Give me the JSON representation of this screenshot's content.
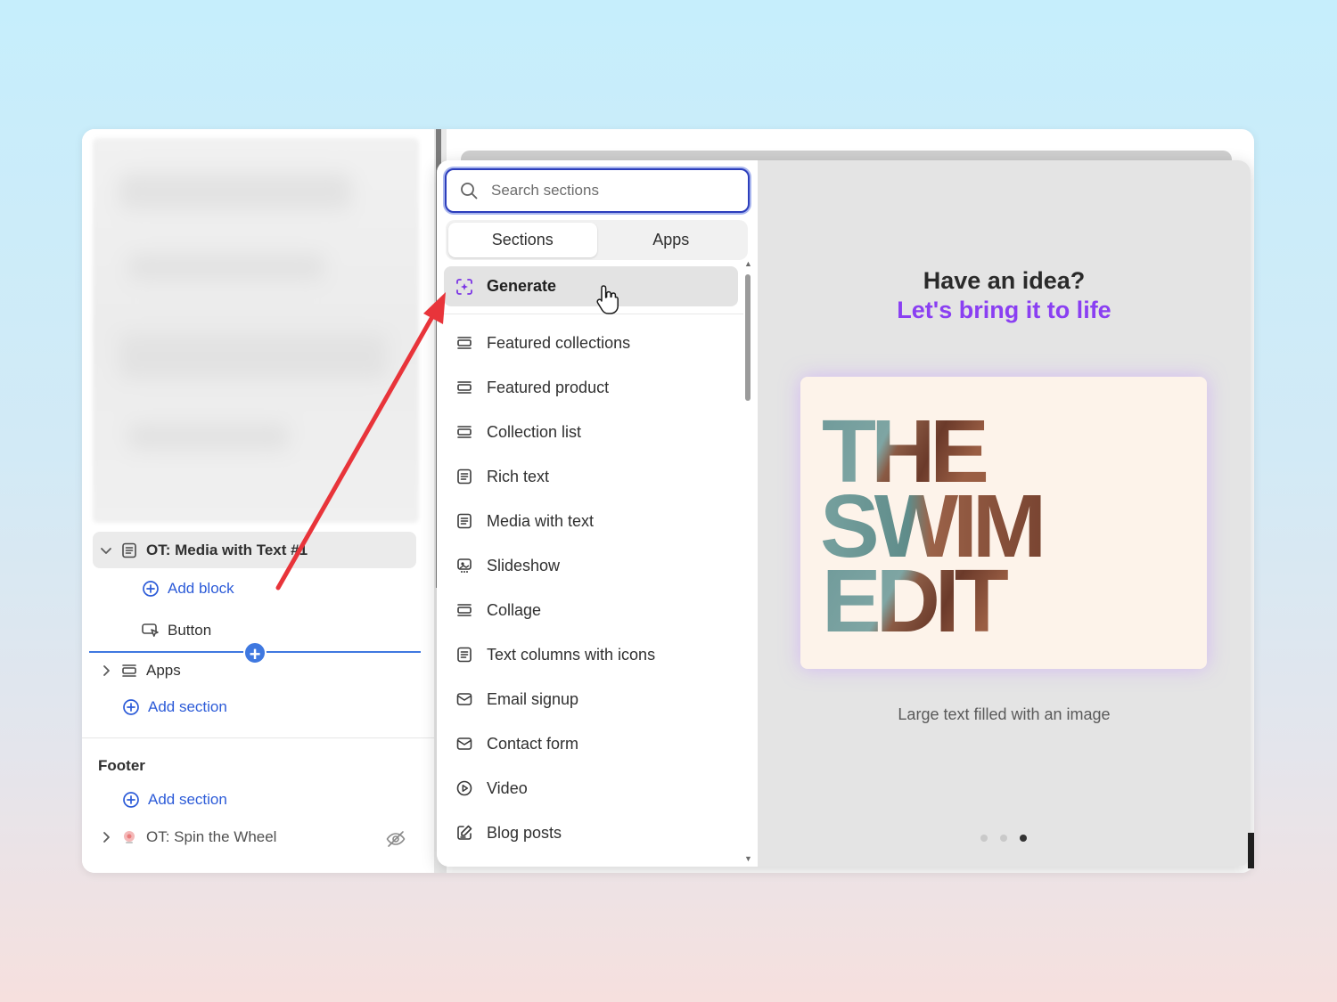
{
  "sidebar": {
    "selected_section": "OT: Media with Text #1",
    "add_block": "Add block",
    "button_block": "Button",
    "apps_section": "Apps",
    "add_section": "Add section",
    "footer": {
      "title": "Footer",
      "add_section": "Add section",
      "spin_wheel": "OT: Spin the Wheel"
    }
  },
  "panel": {
    "search": {
      "placeholder": "Search sections",
      "value": ""
    },
    "tabs": [
      {
        "label": "Sections",
        "active": true
      },
      {
        "label": "Apps",
        "active": false
      }
    ],
    "generate": {
      "label": "Generate",
      "icon": "sparkle-frame-icon"
    },
    "items": [
      {
        "label": "Featured collections",
        "icon": "layout-rows-icon"
      },
      {
        "label": "Featured product",
        "icon": "layout-rows-icon"
      },
      {
        "label": "Collection list",
        "icon": "layout-rows-icon"
      },
      {
        "label": "Rich text",
        "icon": "text-block-icon"
      },
      {
        "label": "Media with text",
        "icon": "text-block-icon"
      },
      {
        "label": "Slideshow",
        "icon": "slideshow-icon"
      },
      {
        "label": "Collage",
        "icon": "layout-rows-icon"
      },
      {
        "label": "Text columns with icons",
        "icon": "text-block-icon"
      },
      {
        "label": "Email signup",
        "icon": "envelope-icon"
      },
      {
        "label": "Contact form",
        "icon": "envelope-icon"
      },
      {
        "label": "Video",
        "icon": "play-icon"
      },
      {
        "label": "Blog posts",
        "icon": "edit-note-icon"
      }
    ]
  },
  "preview": {
    "title": "Have an idea?",
    "subtitle": "Let's bring it to life",
    "image_text": [
      "THE",
      "SWIM",
      "EDIT"
    ],
    "caption": "Large text filled with an image",
    "carousel": {
      "count": 3,
      "active_index": 2
    }
  },
  "colors": {
    "accent_purple": "#8a3ff2",
    "link_blue": "#2c5bd8",
    "focus_ring": "#2c3ebc",
    "arrow_red": "#e8343a"
  }
}
